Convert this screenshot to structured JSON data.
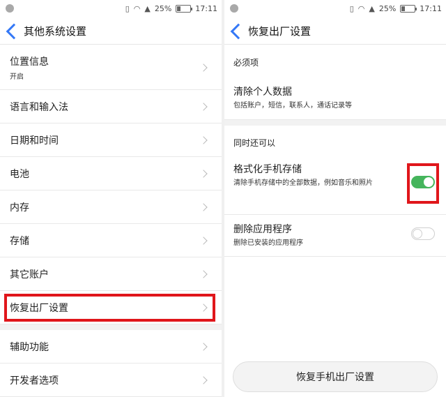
{
  "status": {
    "battery": "25%",
    "time": "17:11"
  },
  "left": {
    "title": "其他系统设置",
    "items": [
      {
        "label": "位置信息",
        "sub": "开启"
      },
      {
        "label": "语言和输入法"
      },
      {
        "label": "日期和时间"
      },
      {
        "label": "电池"
      },
      {
        "label": "内存"
      },
      {
        "label": "存储"
      },
      {
        "label": "其它账户"
      },
      {
        "label": "恢复出厂设置"
      },
      {
        "label": "辅助功能"
      },
      {
        "label": "开发者选项"
      }
    ]
  },
  "right": {
    "title": "恢复出厂设置",
    "required_header": "必须项",
    "clear_personal": {
      "label": "清除个人数据",
      "sub": "包括账户，短信，联系人，通话记录等"
    },
    "also_header": "同时还可以",
    "format_storage": {
      "label": "格式化手机存储",
      "sub": "清除手机存储中的全部数据，例如音乐和照片",
      "enabled": true
    },
    "delete_apps": {
      "label": "删除应用程序",
      "sub": "删除已安装的应用程序",
      "enabled": false
    },
    "reset_button": "恢复手机出厂设置"
  },
  "colors": {
    "accent": "#3478f6",
    "toggle_on": "#45b55c",
    "highlight": "#e0161b"
  }
}
